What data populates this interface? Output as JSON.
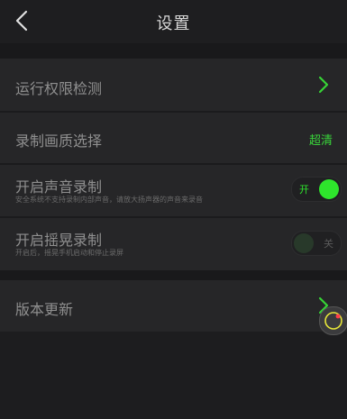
{
  "header": {
    "title": "设置"
  },
  "items": [
    {
      "label": "运行权限检测"
    },
    {
      "label": "录制画质选择",
      "value": "超清"
    },
    {
      "label": "开启声音录制",
      "sub": "安全系统不支持录制内部声音，请放大扬声器的声音来录音",
      "toggle_label": "开",
      "on": true
    },
    {
      "label": "开启摇晃录制",
      "sub": "开启后，摇晃手机启动和停止录屏",
      "toggle_label": "关",
      "on": false
    },
    {
      "label": "版本更新"
    }
  ],
  "colors": {
    "accent": "#2ee52c",
    "background": "#1d1d1f",
    "row": "#262628"
  },
  "icons": [
    "back-arrow-icon",
    "chevron-right-icon",
    "floating-assist-icon"
  ]
}
